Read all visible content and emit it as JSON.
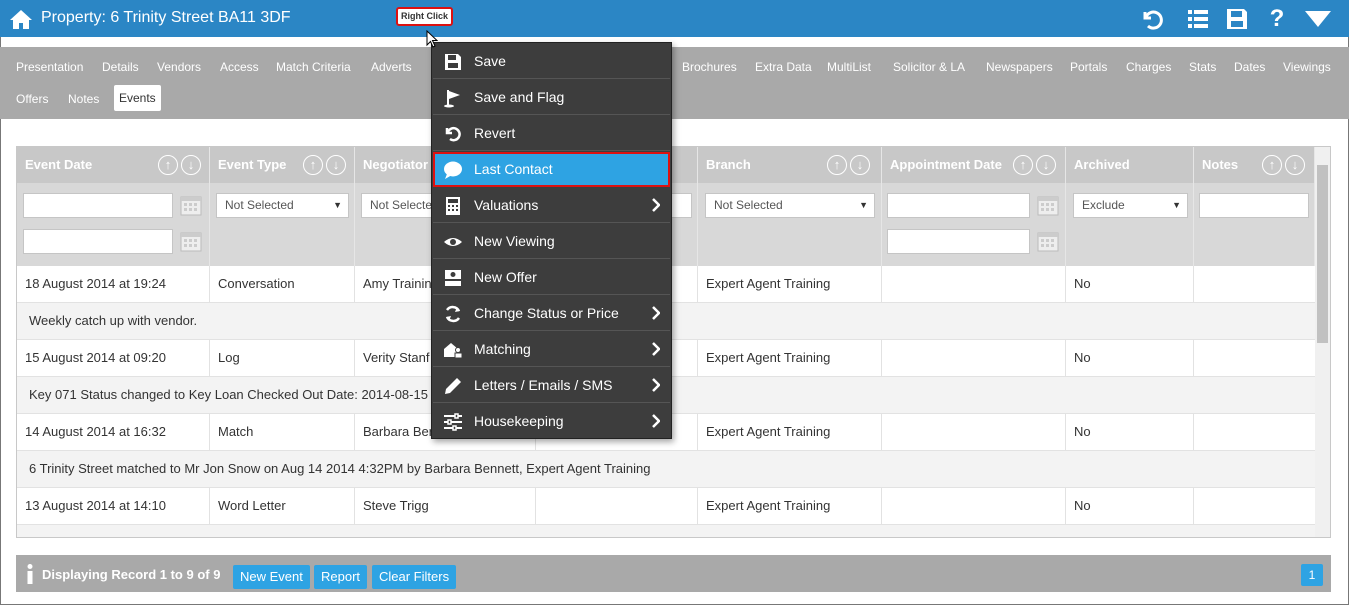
{
  "header": {
    "title": "Property: 6 Trinity Street BA11 3DF",
    "icons": [
      "home-icon",
      "undo-icon",
      "list-icon",
      "save-icon",
      "help-icon",
      "dropdown-icon"
    ],
    "help_glyph": "?"
  },
  "tabs": [
    {
      "label": "Presentation"
    },
    {
      "label": "Details"
    },
    {
      "label": "Vendors"
    },
    {
      "label": "Access"
    },
    {
      "label": "Match Criteria"
    },
    {
      "label": "Adverts"
    },
    {
      "label": "Brochures"
    },
    {
      "label": "Extra Data"
    },
    {
      "label": "MultiList"
    },
    {
      "label": "Solicitor & LA"
    },
    {
      "label": "Newspapers"
    },
    {
      "label": "Portals"
    },
    {
      "label": "Charges"
    },
    {
      "label": "Stats"
    },
    {
      "label": "Dates"
    },
    {
      "label": "Viewings"
    },
    {
      "label": "Offers"
    },
    {
      "label": "Notes"
    },
    {
      "label": "Events",
      "active": true
    }
  ],
  "grid": {
    "columns": [
      {
        "label": "Event Date"
      },
      {
        "label": "Event Type"
      },
      {
        "label": "Negotiator"
      },
      {
        "label": ""
      },
      {
        "label": "Branch"
      },
      {
        "label": "Appointment Date"
      },
      {
        "label": "Archived"
      },
      {
        "label": "Notes"
      }
    ],
    "filters": {
      "event_type": "Not Selected",
      "negotiator": "Not Selecte",
      "branch": "Not Selected",
      "archived": "Exclude"
    },
    "rows": [
      {
        "date": "18 August 2014 at 19:24",
        "type": "Conversation",
        "negotiator": "Amy Trainin",
        "branch": "Expert Agent Training",
        "archived": "No",
        "note": "Weekly catch up with vendor."
      },
      {
        "date": "15 August 2014 at 09:20",
        "type": "Log",
        "negotiator": "Verity Stanf",
        "branch": "Expert Agent Training",
        "archived": "No",
        "note": "Key 071 Status changed to Key Loan Checked Out Date: 2014-08-15 T"
      },
      {
        "date": "14 August 2014 at 16:32",
        "type": "Match",
        "negotiator": "Barbara Ber",
        "branch": "Expert Agent Training",
        "archived": "No",
        "note": "6 Trinity Street matched to Mr Jon Snow on Aug 14 2014 4:32PM by Barbara Bennett, Expert Agent Training"
      },
      {
        "date": "13 August 2014 at 14:10",
        "type": "Word Letter",
        "negotiator": "Steve Trigg",
        "branch": "Expert Agent Training",
        "archived": "No",
        "note": ""
      }
    ]
  },
  "footer": {
    "status": "Displaying Record 1 to 9 of 9",
    "new_event": "New Event",
    "report": "Report",
    "clear_filters": "Clear Filters",
    "page": "1"
  },
  "context_menu": {
    "items": [
      {
        "label": "Save",
        "icon": "save-icon",
        "submenu": false
      },
      {
        "label": "Save and Flag",
        "icon": "flag-icon",
        "submenu": false
      },
      {
        "label": "Revert",
        "icon": "undo-icon",
        "submenu": false
      },
      {
        "label": "Last Contact",
        "icon": "speech-bubble-icon",
        "submenu": false,
        "highlighted": true
      },
      {
        "label": "Valuations",
        "icon": "calculator-icon",
        "submenu": true
      },
      {
        "label": "New Viewing",
        "icon": "eye-icon",
        "submenu": false
      },
      {
        "label": "New Offer",
        "icon": "money-icon",
        "submenu": false
      },
      {
        "label": "Change Status or Price",
        "icon": "refresh-icon",
        "submenu": true
      },
      {
        "label": "Matching",
        "icon": "house-people-icon",
        "submenu": true
      },
      {
        "label": "Letters / Emails / SMS",
        "icon": "pencil-icon",
        "submenu": true
      },
      {
        "label": "Housekeeping",
        "icon": "sliders-icon",
        "submenu": true
      }
    ]
  },
  "callout": {
    "label": "Right Click"
  },
  "colors": {
    "header": "#2b86c5",
    "tab_bar": "#a9a9a9",
    "accent": "#2ea3e3",
    "menu_bg": "#3d3d3d",
    "highlight_border": "#dd1111"
  }
}
